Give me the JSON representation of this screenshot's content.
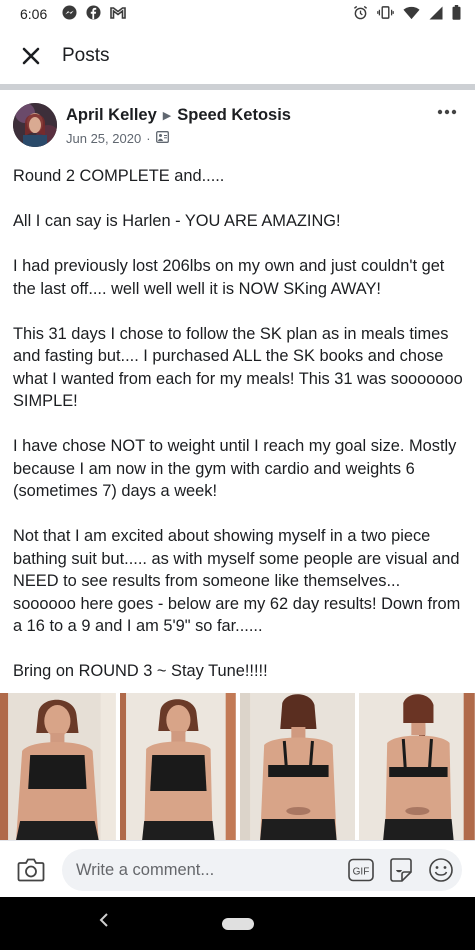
{
  "status_bar": {
    "time": "6:06",
    "left_icons": [
      "messenger-icon",
      "facebook-icon",
      "gmail-icon"
    ],
    "right_icons": [
      "alarm-icon",
      "vibrate-icon",
      "wifi-icon",
      "signal-icon",
      "battery-icon"
    ]
  },
  "header": {
    "title": "Posts"
  },
  "post": {
    "author": "April Kelley",
    "group": "Speed Ketosis",
    "date": "Jun 25, 2020",
    "separator": "·",
    "paragraphs": [
      "Round 2 COMPLETE and.....",
      "All I can say is Harlen - YOU ARE AMAZING!",
      "I had previously lost 206lbs on my own and just couldn't get the last off.... well well well it is NOW SKing AWAY!",
      "This 31 days I chose to follow the SK plan as in meals times and fasting but.... I purchased ALL the SK books and chose what I wanted from each for my meals!  This 31 was sooooooo SIMPLE!",
      "I have chose NOT to weight until I reach my goal size. Mostly because I am now in the gym with cardio and weights 6 (sometimes 7) days a week!",
      "Not that I am excited about showing myself in a two piece bathing suit but..... as with myself some people are visual and NEED to see results from someone like themselves... soooooo here goes - below are my 62 day results! Down from a 16 to a 9 and I am 5'9\" so far......",
      "Bring on ROUND 3 ~ Stay Tune!!!!!"
    ]
  },
  "comment_bar": {
    "placeholder": "Write a comment..."
  }
}
